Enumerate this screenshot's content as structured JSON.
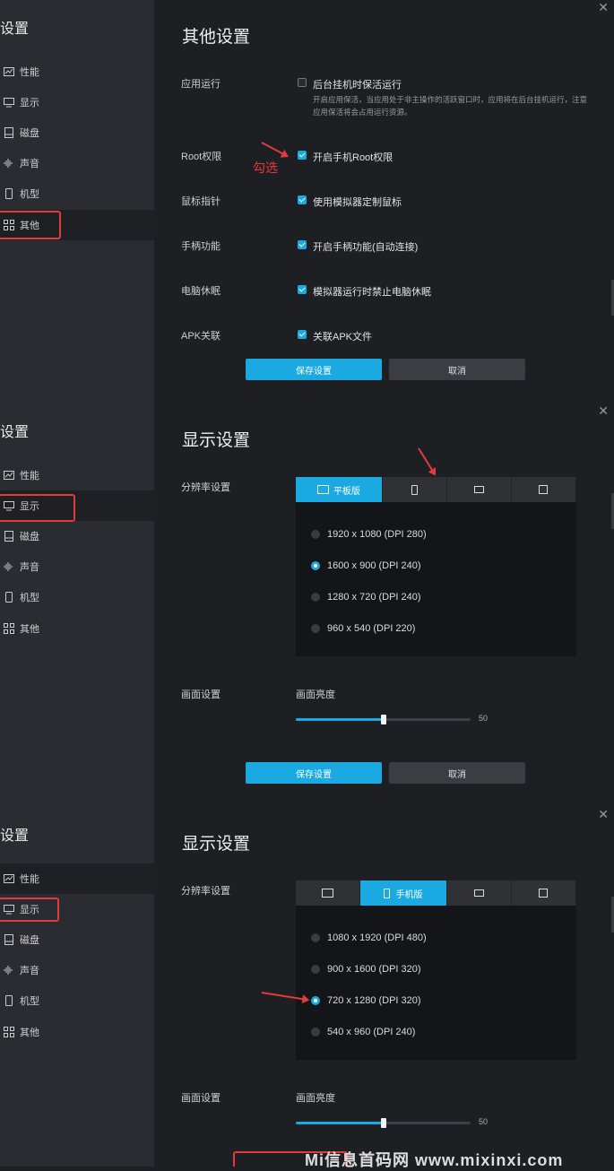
{
  "panel1": {
    "sidebar_title": "设置",
    "nav": [
      "性能",
      "显示",
      "磁盘",
      "声音",
      "机型",
      "其他"
    ],
    "heading": "其他设置",
    "close": "✕",
    "rows": [
      {
        "label": "应用运行",
        "checkbox": "后台挂机时保活运行",
        "checked": false,
        "hint": "开启应用保活，当应用处于非主操作的活跃窗口时，应用将在后台挂机运行，注意应用保活将会占用运行资源。"
      },
      {
        "label": "Root权限",
        "checkbox": "开启手机Root权限",
        "checked": true
      },
      {
        "label": "鼠标指针",
        "checkbox": "使用模拟器定制鼠标",
        "checked": true
      },
      {
        "label": "手柄功能",
        "checkbox": "开启手柄功能(自动连接)",
        "checked": true
      },
      {
        "label": "电脑休眠",
        "checkbox": "模拟器运行时禁止电脑休眠",
        "checked": true
      },
      {
        "label": "APK关联",
        "checkbox": "关联APK文件",
        "checked": true
      }
    ],
    "annotation": "勾选",
    "save": "保存设置",
    "cancel": "取消"
  },
  "panel2": {
    "sidebar_title": "设置",
    "nav": [
      "性能",
      "显示",
      "磁盘",
      "声音",
      "机型",
      "其他"
    ],
    "heading": "显示设置",
    "close": "✕",
    "resolution_label": "分辨率设置",
    "tab_selected": "平板版",
    "resolutions": [
      "1920 x 1080 (DPI 280)",
      "1600 x 900 (DPI 240)",
      "1280 x 720 (DPI 240)",
      "960 x 540 (DPI 220)"
    ],
    "selected_index": 1,
    "screen_label": "画面设置",
    "brightness_label": "画面亮度",
    "brightness_value": "50",
    "brightness_fraction": 0.5,
    "save": "保存设置",
    "cancel": "取消"
  },
  "panel3": {
    "sidebar_title": "设置",
    "nav": [
      "性能",
      "显示",
      "磁盘",
      "声音",
      "机型",
      "其他"
    ],
    "heading": "显示设置",
    "close": "✕",
    "resolution_label": "分辨率设置",
    "tab_selected": "手机版",
    "resolutions": [
      "1080 x 1920 (DPI 480)",
      "900 x 1600 (DPI 320)",
      "720 x 1280 (DPI 320)",
      "540 x 960 (DPI 240)"
    ],
    "selected_index": 2,
    "screen_label": "画面设置",
    "brightness_label": "画面亮度",
    "brightness_value": "50",
    "brightness_fraction": 0.5
  },
  "watermark": "Mi信息首码网  www.mixinxi.com",
  "colors": {
    "accent": "#1ba9e1",
    "annotation": "#e23b3b"
  }
}
